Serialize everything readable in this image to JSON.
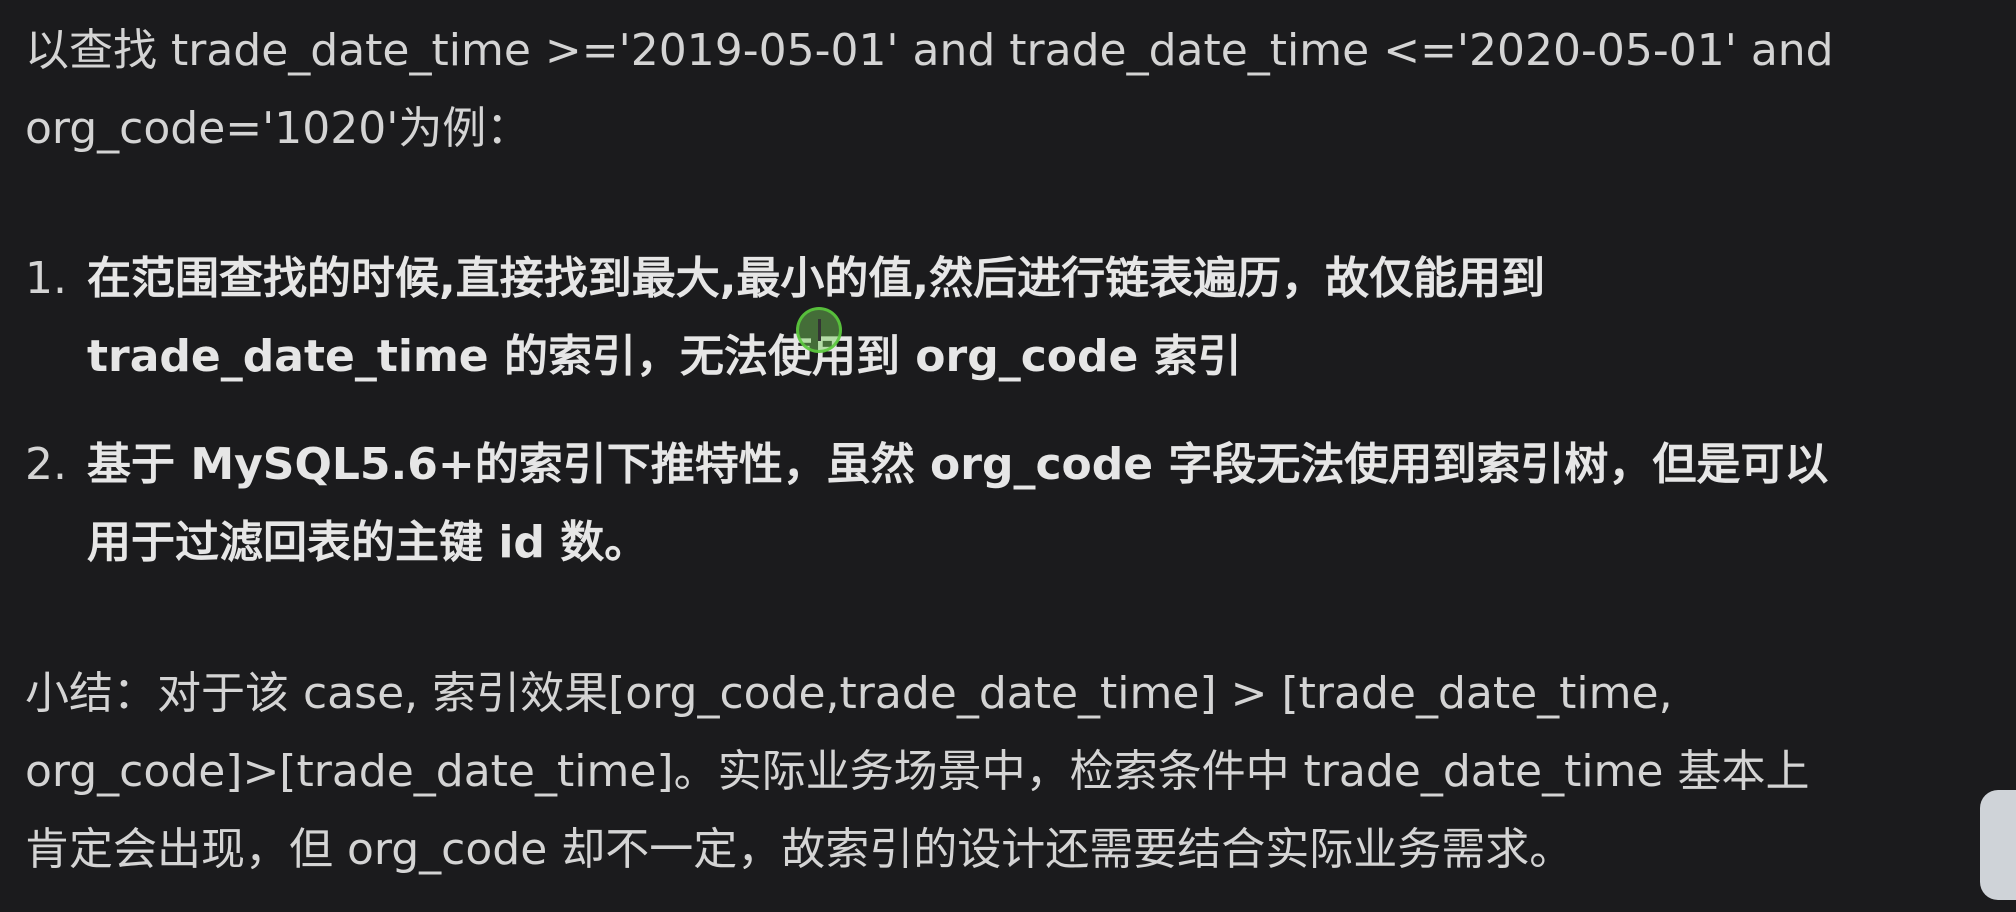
{
  "intro": {
    "line1": "以查找 trade_date_time >='2019-05-01' and trade_date_time <='2020-05-01' and",
    "line2": "org_code='1020'为例："
  },
  "list": [
    {
      "number": "1.",
      "line1": "在范围查找的时候,直接找到最大,最小的值,然后进行链表遍历，故仅能用到",
      "line2": "trade_date_time 的索引，无法使用到 org_code 索引"
    },
    {
      "number": "2.",
      "line1": "基于 MySQL5.6+的索引下推特性，虽然 org_code 字段无法使用到索引树，但是可以",
      "line2": "用于过滤回表的主键 id 数。"
    }
  ],
  "summary": {
    "line1": "小结：对于该 case, 索引效果[org_code,trade_date_time] > [trade_date_time,",
    "line2": "org_code]>[trade_date_time]。实际业务场景中，检索条件中 trade_date_time 基本上",
    "line3": "肯定会出现，但 org_code 却不一定，故索引的设计还需要结合实际业务需求。"
  },
  "icons": {
    "cursor": "text-cursor-highlight-icon",
    "corner": "side-panel-handle-icon"
  },
  "colors": {
    "background": "#1b1b1d",
    "text": "#d4d4d4",
    "cursor_ring": "#5ac83c"
  }
}
